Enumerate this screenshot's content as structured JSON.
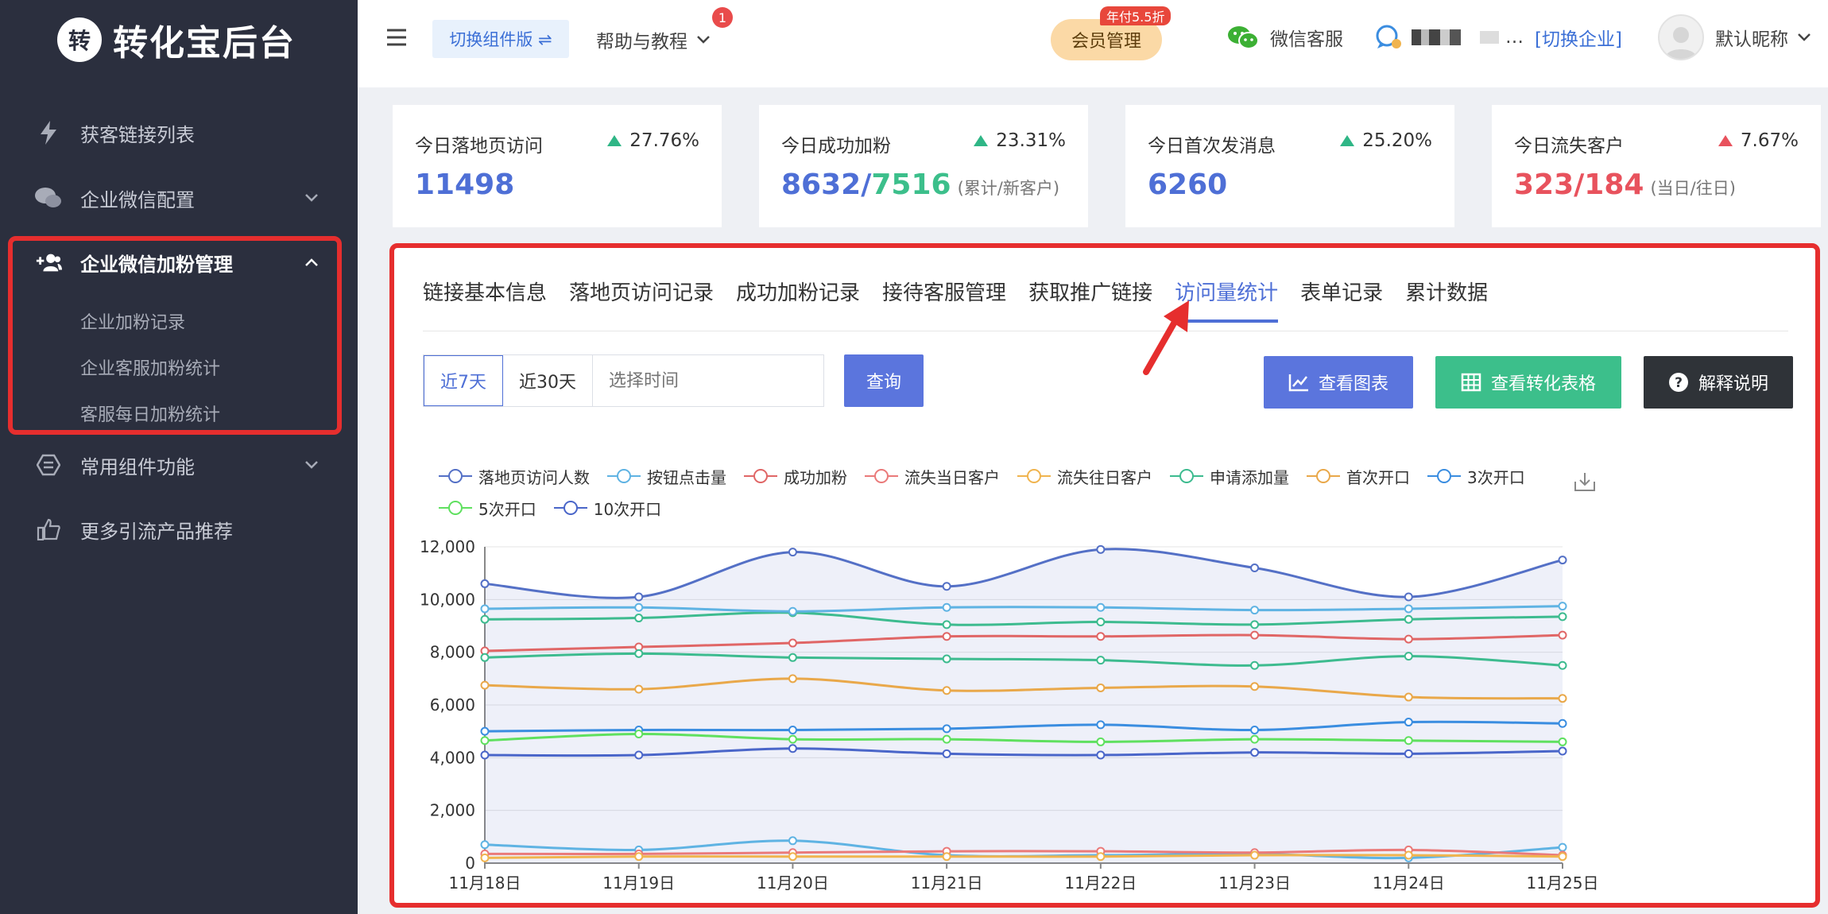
{
  "app": {
    "logo_char": "转",
    "title": "转化宝后台"
  },
  "sidebar": {
    "items": [
      {
        "label": "获客链接列表",
        "icon": "lightning-icon"
      },
      {
        "label": "企业微信配置",
        "icon": "chat-bubbles-icon"
      },
      {
        "label": "企业微信加粉管理",
        "icon": "add-user-icon"
      },
      {
        "label": "常用组件功能",
        "icon": "component-icon"
      },
      {
        "label": "更多引流产品推荐",
        "icon": "thumbs-up-icon"
      }
    ],
    "sub_items": [
      {
        "label": "企业加粉记录"
      },
      {
        "label": "企业客服加粉统计"
      },
      {
        "label": "客服每日加粉统计"
      }
    ]
  },
  "header": {
    "switch_version": "切换组件版 ⇌",
    "help": "帮助与教程",
    "help_badge": "1",
    "member": "会员管理",
    "promo": "年付5.5折",
    "wechat_service": "微信客服",
    "company_name": "…",
    "switch_company": "[切换企业]",
    "nickname": "默认昵称"
  },
  "stats": [
    {
      "title": "今日落地页访问",
      "change": "27.76%",
      "trend": "up",
      "value": "11498"
    },
    {
      "title": "今日成功加粉",
      "change": "23.31%",
      "trend": "up",
      "value": "8632",
      "value2": "7516",
      "sub": "(累计/新客户)"
    },
    {
      "title": "今日首次发消息",
      "change": "25.20%",
      "trend": "up",
      "value": "6260"
    },
    {
      "title": "今日流失客户",
      "change": "7.67%",
      "trend": "up-red",
      "value": "323/184",
      "sub": "(当日/往日)"
    }
  ],
  "tabs": [
    {
      "label": "链接基本信息"
    },
    {
      "label": "落地页访问记录"
    },
    {
      "label": "成功加粉记录"
    },
    {
      "label": "接待客服管理"
    },
    {
      "label": "获取推广链接"
    },
    {
      "label": "访问量统计",
      "active": true
    },
    {
      "label": "表单记录"
    },
    {
      "label": "累计数据"
    }
  ],
  "filters": {
    "ranges": [
      {
        "label": "近7天",
        "active": true
      },
      {
        "label": "近30天"
      }
    ],
    "date_placeholder": "选择时间",
    "query": "查询"
  },
  "actions": {
    "chart": "查看图表",
    "table": "查看转化表格",
    "explain": "解释说明"
  },
  "colors": {
    "accent": "#4e6fd6",
    "green": "#2fb686",
    "red": "#e8525d",
    "sidebar": "#2b2f3e",
    "highlight": "#e62e2e"
  },
  "chart_data": {
    "type": "line",
    "x": [
      "11月18日",
      "11月19日",
      "11月20日",
      "11月21日",
      "11月22日",
      "11月23日",
      "11月24日",
      "11月25日"
    ],
    "ylim": [
      0,
      12000
    ],
    "yticks": [
      "0",
      "2,000",
      "4,000",
      "6,000",
      "8,000",
      "10,000",
      "12,000"
    ],
    "grid": true,
    "legend": "top",
    "series": [
      {
        "name": "落地页访问人数",
        "color": "#5470c6",
        "area": true,
        "values": [
          10600,
          10100,
          11800,
          10500,
          11900,
          11200,
          10100,
          11500
        ]
      },
      {
        "name": "按钮点击量",
        "color": "#5fb3e3",
        "values": [
          700,
          500,
          850,
          300,
          300,
          350,
          200,
          600
        ]
      },
      {
        "name": "成功加粉",
        "color": "#e06666",
        "values": [
          8050,
          8200,
          8350,
          8600,
          8600,
          8650,
          8500,
          8650
        ]
      },
      {
        "name": "流失当日客户",
        "color": "#ea7a7a",
        "values": [
          350,
          350,
          400,
          450,
          450,
          400,
          500,
          300
        ]
      },
      {
        "name": "流失往日客户",
        "color": "#f0b44f",
        "values": [
          200,
          250,
          250,
          250,
          250,
          300,
          300,
          250
        ]
      },
      {
        "name": "申请添加量",
        "color": "#3dbb8f",
        "values": [
          7800,
          7950,
          7800,
          7750,
          7700,
          7500,
          7850,
          7500
        ]
      },
      {
        "name": "首次开口",
        "color": "#e9a84a",
        "values": [
          6750,
          6600,
          7000,
          6550,
          6650,
          6700,
          6300,
          6250
        ]
      },
      {
        "name": "3次开口",
        "color": "#3a8de0",
        "values": [
          5000,
          5050,
          5050,
          5100,
          5250,
          5050,
          5350,
          5300
        ]
      },
      {
        "name": "5次开口",
        "color": "#5fe05f",
        "values": [
          4650,
          4900,
          4700,
          4700,
          4600,
          4700,
          4650,
          4600
        ]
      },
      {
        "name": "10次开口",
        "color": "#4a66c9",
        "values": [
          4100,
          4100,
          4350,
          4150,
          4100,
          4200,
          4150,
          4250
        ]
      },
      {
        "name": "",
        "color": "#3dbb8f",
        "values": [
          9250,
          9300,
          9500,
          9050,
          9150,
          9050,
          9250,
          9350
        ]
      },
      {
        "name": "",
        "color": "#5fb3e3",
        "values": [
          9650,
          9700,
          9550,
          9700,
          9700,
          9600,
          9650,
          9750
        ]
      }
    ]
  }
}
